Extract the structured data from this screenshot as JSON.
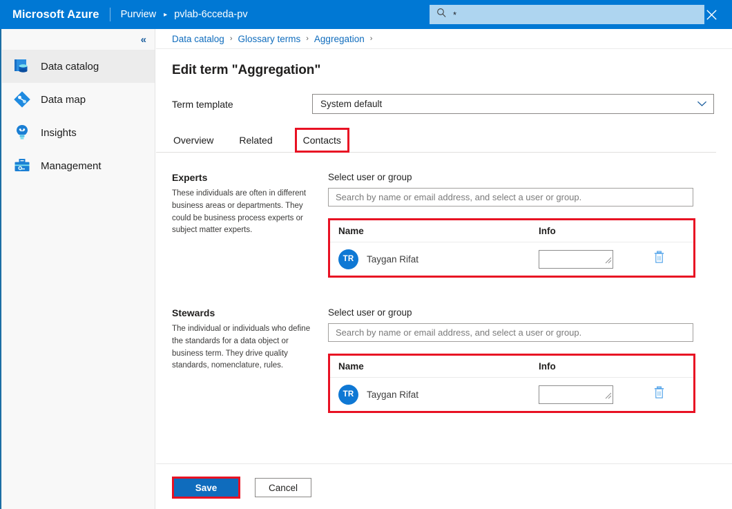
{
  "topbar": {
    "brand": "Microsoft Azure",
    "service": "Purview",
    "account": "pvlab-6cceda-pv",
    "arrow": "▸",
    "search": {
      "icon": "search-icon",
      "value": "*",
      "close_icon": "close-icon"
    }
  },
  "sidebar": {
    "collapse_icon": "«",
    "items": [
      {
        "label": "Data catalog",
        "icon": "data-catalog-icon",
        "selected": true
      },
      {
        "label": "Data map",
        "icon": "data-map-icon",
        "selected": false
      },
      {
        "label": "Insights",
        "icon": "insights-icon",
        "selected": false
      },
      {
        "label": "Management",
        "icon": "management-icon",
        "selected": false
      }
    ]
  },
  "breadcrumb": {
    "items": [
      "Data catalog",
      "Glossary terms",
      "Aggregation"
    ],
    "separator": "›"
  },
  "page": {
    "title": "Edit term \"Aggregation\"",
    "term_template_label": "Term template",
    "term_template_value": "System default",
    "dropdown_icon": "chevron-down-icon"
  },
  "tabs": [
    {
      "label": "Overview",
      "active": false,
      "annotated": false
    },
    {
      "label": "Related",
      "active": false,
      "annotated": false
    },
    {
      "label": "Contacts",
      "active": true,
      "annotated": true
    }
  ],
  "sections": [
    {
      "id": "experts",
      "title": "Experts",
      "description": "These individuals are often in different business areas or departments. They could be business process experts or subject matter experts.",
      "field_label": "Select user or group",
      "placeholder": "Search by name or email address, and select a user or group.",
      "columns": [
        "Name",
        "Info"
      ],
      "rows": [
        {
          "initials": "TR",
          "name": "Taygan Rifat",
          "info": "",
          "delete_icon": "trash-icon"
        }
      ]
    },
    {
      "id": "stewards",
      "title": "Stewards",
      "description": "The individual or individuals who define the standards for a data object or business term. They drive quality standards, nomenclature, rules.",
      "field_label": "Select user or group",
      "placeholder": "Search by name or email address, and select a user or group.",
      "columns": [
        "Name",
        "Info"
      ],
      "rows": [
        {
          "initials": "TR",
          "name": "Taygan Rifat",
          "info": "",
          "delete_icon": "trash-icon"
        }
      ]
    }
  ],
  "footer": {
    "save_label": "Save",
    "cancel_label": "Cancel"
  },
  "colors": {
    "azure_blue": "#0078d4",
    "annotation_red": "#e81123",
    "link_blue": "#0f6cbd",
    "avatar_blue": "#0f78d4"
  }
}
